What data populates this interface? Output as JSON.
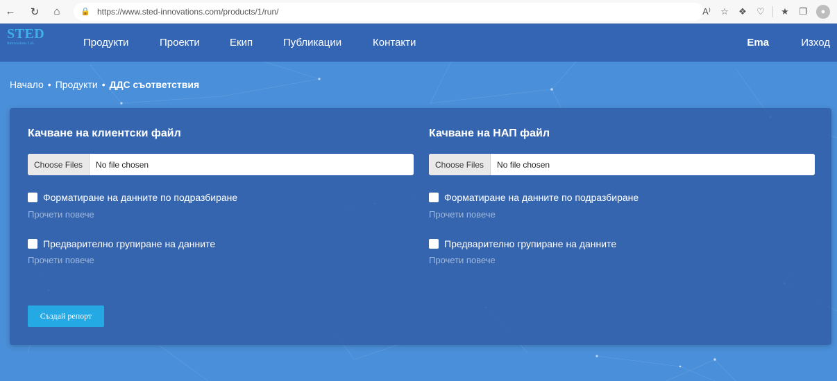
{
  "browser": {
    "url": "https://www.sted-innovations.com/products/1/run/",
    "icons": [
      "back-icon",
      "reload-icon",
      "home-icon",
      "lock-icon",
      "read-aloud-icon",
      "favorite-add-icon",
      "extensions-icon",
      "browser-essentials-icon",
      "favorites-icon",
      "collections-icon",
      "profile-icon"
    ]
  },
  "site": {
    "logo_main": "STED",
    "logo_sub": "Innovations Ltd.",
    "nav": {
      "products": "Продукти",
      "projects": "Проекти",
      "team": "Екип",
      "publications": "Публикации",
      "contacts": "Контакти"
    },
    "user": "Ema",
    "logout": "Изход"
  },
  "breadcrumb": {
    "home": "Начало",
    "products": "Продукти",
    "current": "ДДС съответствия",
    "separator": "•"
  },
  "left": {
    "title": "Качване на клиентски файл",
    "file_button": "Choose Files",
    "file_status": "No file chosen",
    "option1": "Форматиране на данните по подразбиране",
    "readmore1": "Прочети повече",
    "option2": "Предварително групиране на данните",
    "readmore2": "Прочети повече"
  },
  "right": {
    "title": "Качване на НАП файл",
    "file_button": "Choose Files",
    "file_status": "No file chosen",
    "option1": "Форматиране на данните по подразбиране",
    "readmore1": "Прочети повече",
    "option2": "Предварително групиране на данните",
    "readmore2": "Прочети повече"
  },
  "create_button": "Създай репорт",
  "colors": {
    "background": "#4a8fd9",
    "navbar": "#3465b4",
    "panel": "#3460aa",
    "accent_button": "#25a9e4",
    "logo": "#3fb0e8"
  }
}
